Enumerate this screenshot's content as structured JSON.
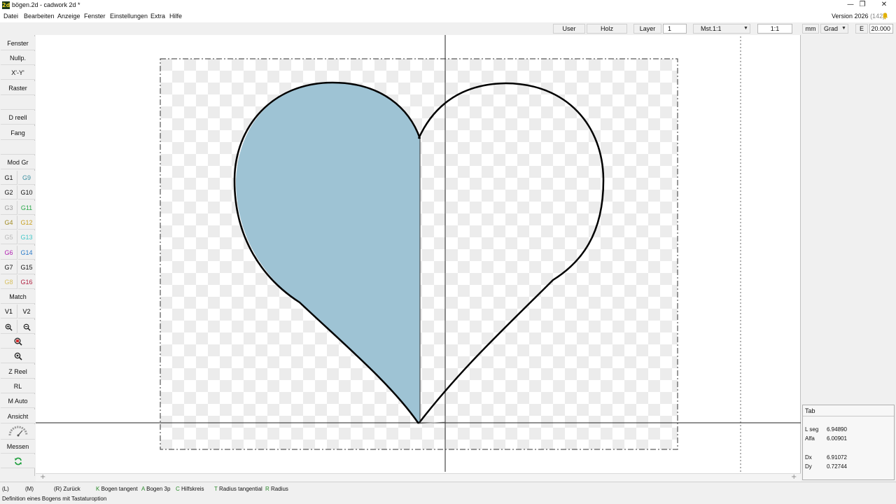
{
  "window": {
    "title": "bögen.2d - cadwork 2d  *",
    "app_icon_glyph": "2d",
    "controls": {
      "minimize": "—",
      "restore": "❐",
      "close": "✕"
    }
  },
  "menu": {
    "items": [
      "Datei",
      "Bearbeiten",
      "Anzeige",
      "Fenster",
      "Einstellungen",
      "Extra",
      "Hilfe"
    ],
    "version_label": "Version 2026",
    "version_build": "(142)",
    "bell_icon": "bell-icon"
  },
  "toolbar": {
    "user": "User",
    "holz": "Holz",
    "layer_label": "Layer",
    "layer_value": "1",
    "scale_value": "Mst.1:1",
    "ratio": "1:1",
    "unit": "mm",
    "angle_unit": "Grad",
    "e_label": "E",
    "e_value": "20.000",
    "dropdown_glyph": "▼"
  },
  "left_panel": {
    "fenster": "Fenster",
    "nullp": "Nullp.",
    "xy": "X'-Y'",
    "raster": "Raster",
    "d_reell": "D reell",
    "fang": "Fang",
    "mod_gr": "Mod Gr",
    "groups": [
      {
        "left": "G1",
        "right": "G9",
        "left_color": "#111111",
        "right_color": "#3a8fa0"
      },
      {
        "left": "G2",
        "right": "G10",
        "left_color": "#111111",
        "right_color": "#111111"
      },
      {
        "left": "G3",
        "right": "G11",
        "left_color": "#9a9a9a",
        "right_color": "#2aa84a"
      },
      {
        "left": "G4",
        "right": "G12",
        "left_color": "#a08a20",
        "right_color": "#c8a020"
      },
      {
        "left": "G5",
        "right": "G13",
        "left_color": "#b8b8b8",
        "right_color": "#40c8c8"
      },
      {
        "left": "G6",
        "right": "G14",
        "left_color": "#b020b0",
        "right_color": "#2a7ac8"
      },
      {
        "left": "G7",
        "right": "G15",
        "left_color": "#111111",
        "right_color": "#111111"
      },
      {
        "left": "G8",
        "right": "G16",
        "left_color": "#d8c060",
        "right_color": "#b02040"
      }
    ],
    "match": "Match",
    "v1": "V1",
    "v2": "V2",
    "z_reel": "Z Reel",
    "rl": "RL",
    "m_auto": "M Auto",
    "ansicht": "Ansicht",
    "messen": "Messen"
  },
  "canvas": {
    "fill_color": "#9ec3d4",
    "outline_color": "#000000"
  },
  "info": {
    "title": "Tab",
    "rows": [
      {
        "label": "L seg",
        "value": "6.94890"
      },
      {
        "label": "Alfa",
        "value": "6.00901"
      },
      {
        "label": "Dx",
        "value": "6.91072"
      },
      {
        "label": "Dy",
        "value": "0.72744"
      }
    ]
  },
  "status": {
    "l": "(L)",
    "m": "(M)",
    "r_zurueck": "(R) Zurück",
    "options": [
      {
        "key": "K",
        "label": "Bogen tangent"
      },
      {
        "key": "A",
        "label": "Bogen 3p"
      },
      {
        "key": "C",
        "label": "Hilfskreis"
      },
      {
        "key": "T",
        "label": "Radius tangential"
      },
      {
        "key": "R",
        "label": "Radius"
      }
    ],
    "hint": "Definition eines Bogens mit Tastaturoption"
  }
}
